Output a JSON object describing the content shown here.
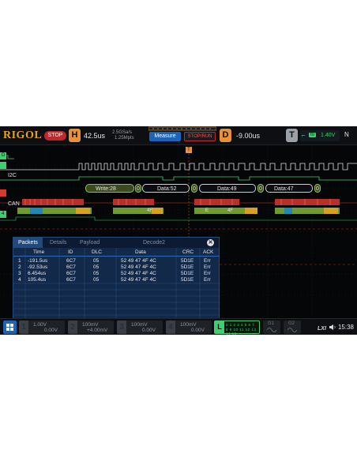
{
  "topbar": {
    "logo": "RIGOL",
    "run_state": "STOP",
    "h_letter": "H",
    "timebase": "42.5us",
    "sample_rate": "2.5GSa/s",
    "memory_depth": "1.25Mpts",
    "measure_label": "Measure",
    "stoprun_label": "STOP/RUN",
    "d_letter": "D",
    "delay": "-9.00us",
    "t_letter": "T",
    "trigger_source": "f0",
    "trigger_level": "1.40V",
    "trigger_mode": "N"
  },
  "channels": {
    "d_label_1": "D",
    "i2c_label": "I2C",
    "can_label": "CAN",
    "ch4_label": "4"
  },
  "decode": {
    "write": "Write:28",
    "i2c_bits": [
      "0",
      "0",
      "0",
      "0"
    ],
    "data": [
      "Data:52",
      "Data:49",
      "Data:47"
    ],
    "can_frag": [
      "4F",
      "4F",
      "E"
    ],
    "trigger_marker": "T"
  },
  "packets": {
    "tabs": [
      "Packets",
      "Details",
      "Payload",
      "Decode2"
    ],
    "close": "✕",
    "columns": [
      "Time",
      "ID",
      "DLC",
      "Data",
      "CRC",
      "ACK"
    ],
    "rows": [
      {
        "idx": "1",
        "time": "-191.5us",
        "id": "6C7",
        "dlc": "05",
        "data": "52 49 47 4F 4C",
        "crc": "5D1E",
        "ack": "Err"
      },
      {
        "idx": "2",
        "time": "-92.53us",
        "id": "6C7",
        "dlc": "05",
        "data": "52 49 47 4F 4C",
        "crc": "5D1E",
        "ack": "Err"
      },
      {
        "idx": "3",
        "time": "6.454us",
        "id": "6C7",
        "dlc": "05",
        "data": "52 49 47 4F 4C",
        "crc": "5D1E",
        "ack": "Err"
      },
      {
        "idx": "4",
        "time": "105.4us",
        "id": "6C7",
        "dlc": "05",
        "data": "52 49 47 4F 4C",
        "crc": "5D1E",
        "ack": "Err"
      }
    ]
  },
  "bottombar": {
    "ch1": {
      "num": "1",
      "scale": "1.00V",
      "offset": "0.00V"
    },
    "ch2": {
      "num": "2",
      "scale": "100mV",
      "offset": "+4.00mV"
    },
    "ch3": {
      "num": "3",
      "scale": "100mV",
      "offset": "0.00V"
    },
    "ch4": {
      "num": "4",
      "scale": "100mV",
      "offset": "0.00V"
    },
    "la_letter": "L",
    "la_row1": "0 1 2 3  4 5 6 7",
    "la_row2": "8 9 10 11 12 13 14 15",
    "g1": "G1",
    "g2": "G2",
    "clock": "15:38"
  },
  "colors": {
    "accent": "#1d63b8",
    "stop": "#c1272d",
    "i2c": "#8fc34a",
    "can": "#d83a2c",
    "digital": "#3bd16f"
  }
}
